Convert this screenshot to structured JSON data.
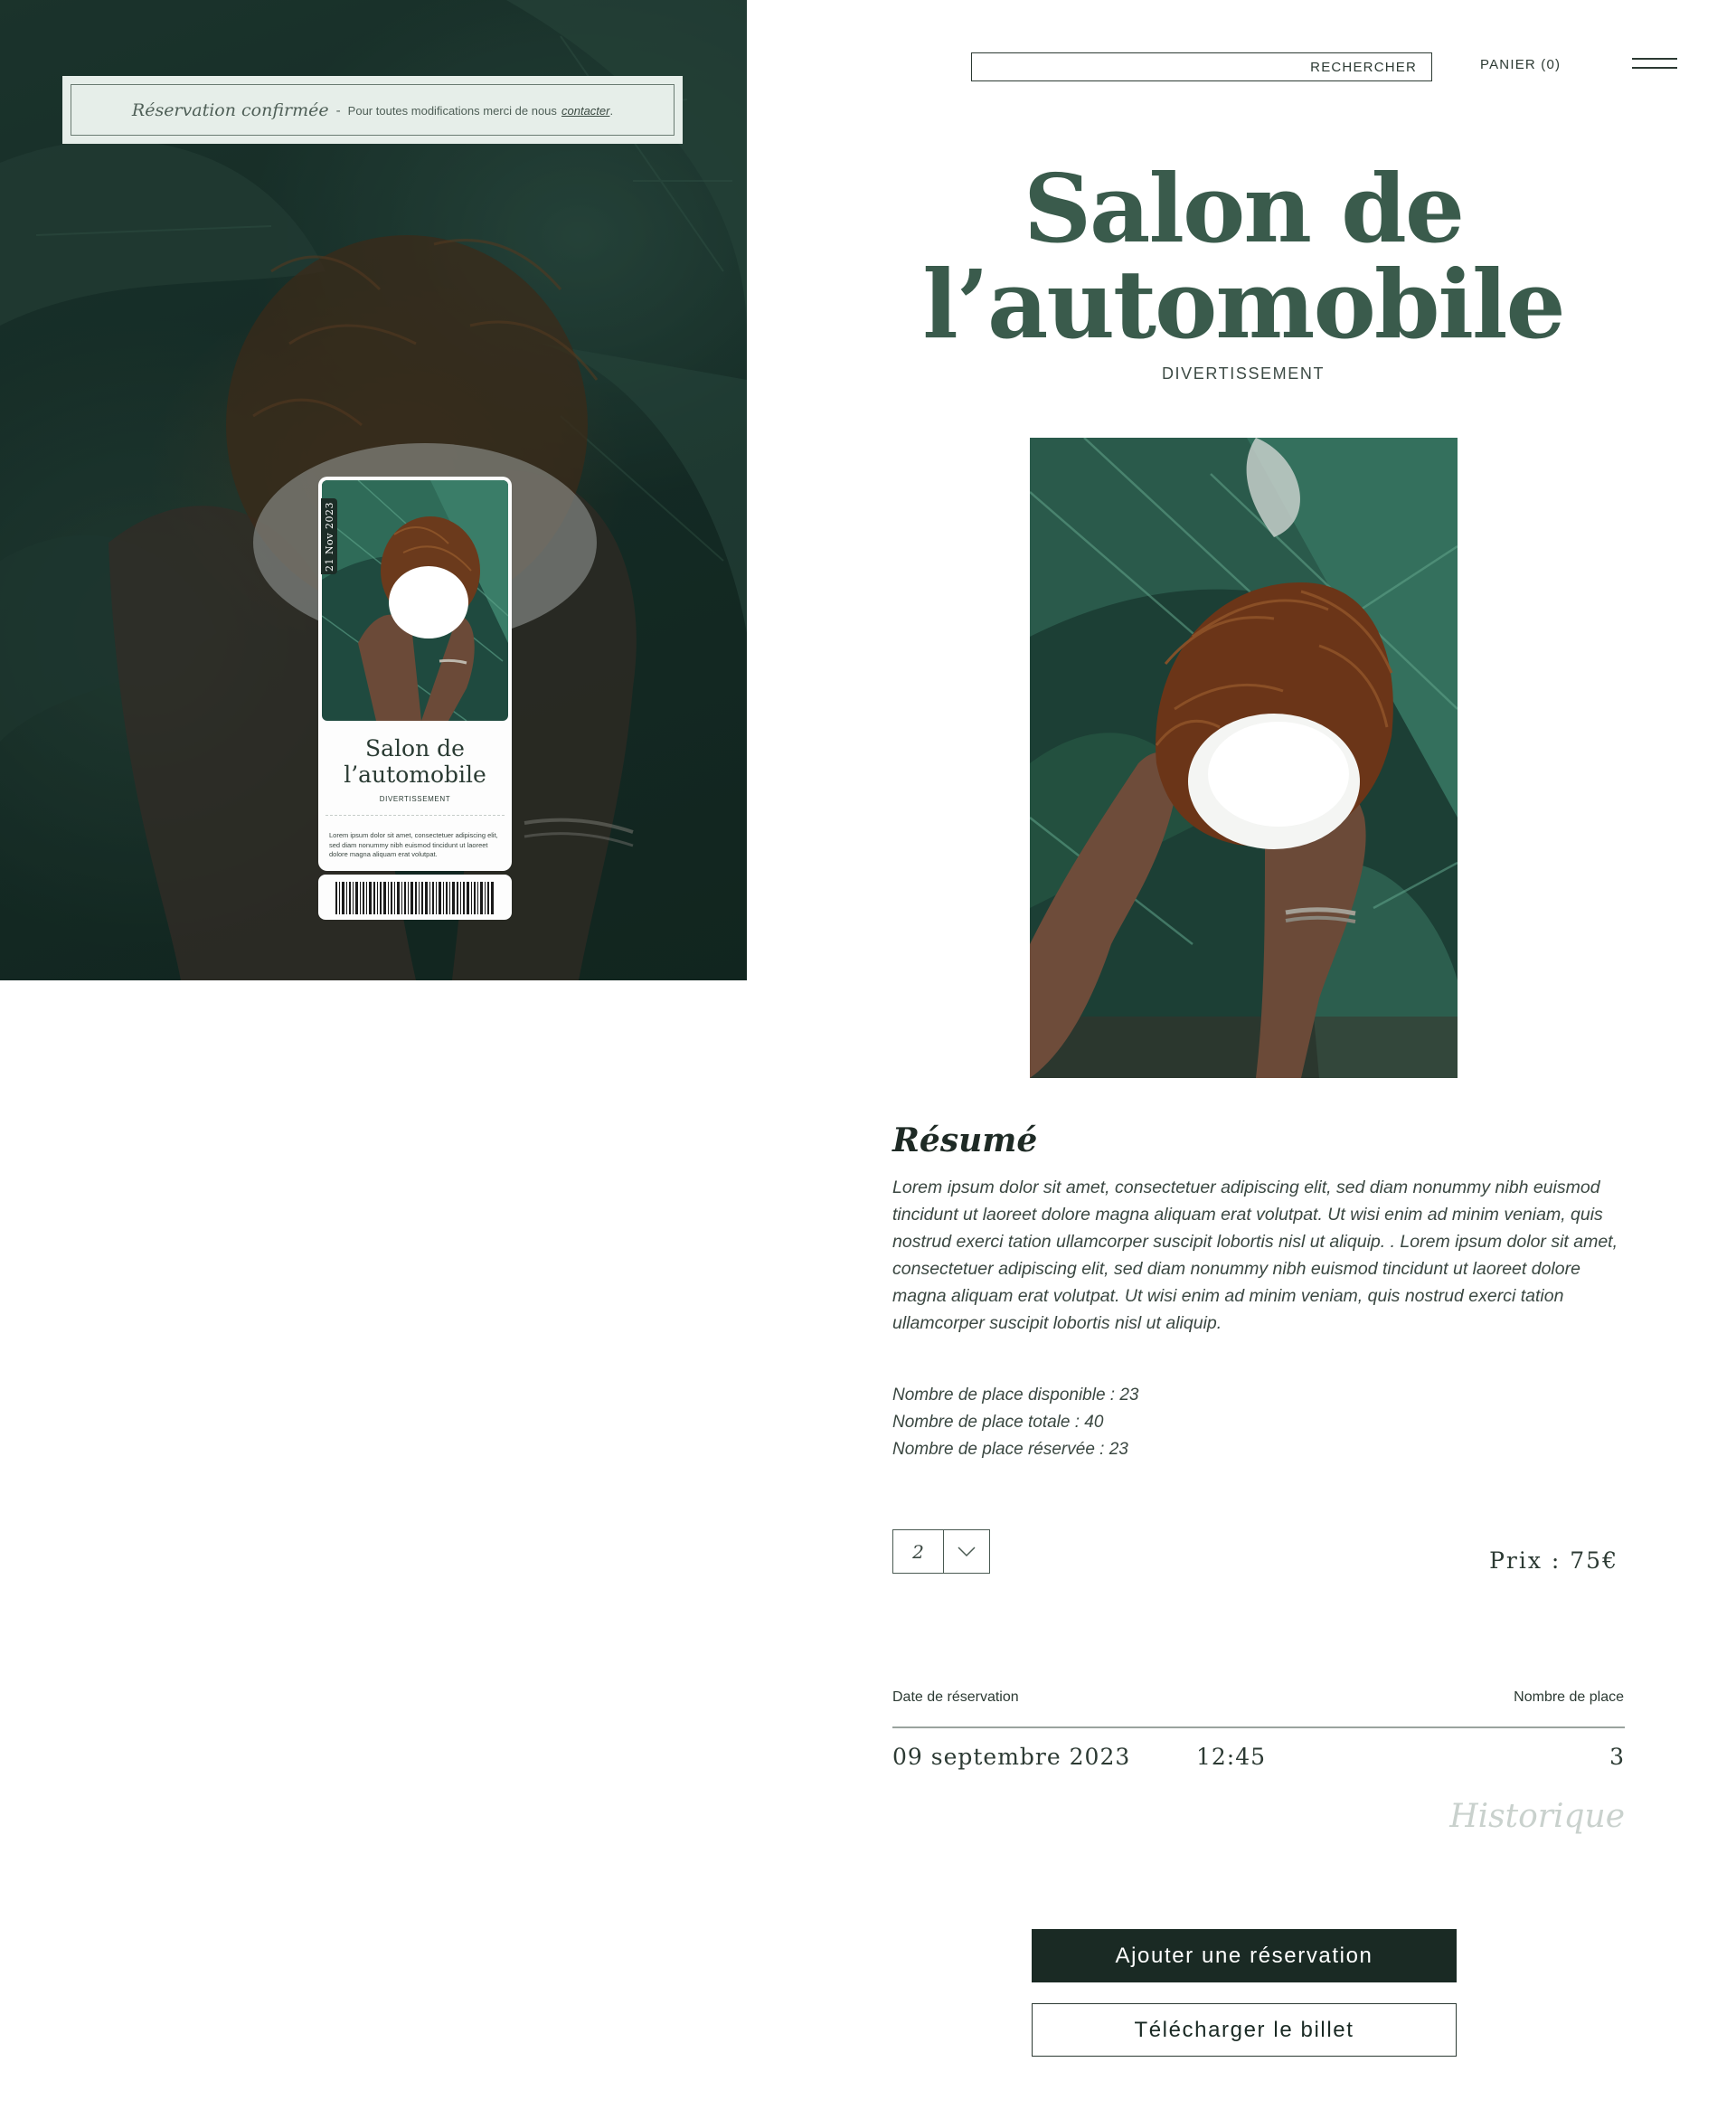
{
  "colors": {
    "brand_green": "#3a5b4c",
    "dark": "#1a2a24",
    "banner_bg": "#e6eee9",
    "muted": "#c9d1cd"
  },
  "banner": {
    "title": "Réservation confirmée",
    "separator": "-",
    "text": "Pour toutes modifications merci de nous",
    "link": "contacter",
    "after_link": "."
  },
  "ticket": {
    "date": "21 Nov 2023",
    "title_line1": "Salon de",
    "title_line2": "l’automobile",
    "category": "DIVERTISSEMENT",
    "description": "Lorem ipsum dolor sit amet, consectetuer adipiscing elit, sed diam nonummy nibh euismod tincidunt ut laoreet dolore magna aliquam erat volutpat."
  },
  "header": {
    "search_label": "RECHERCHER",
    "cart_label": "PANIER (0)",
    "menu_icon": "hamburger-icon"
  },
  "event": {
    "title_line1": "Salon de",
    "title_line2": "l’automobile",
    "category": "DIVERTISSEMENT"
  },
  "summary": {
    "heading": "Résumé",
    "text": "Lorem ipsum dolor sit amet, consectetuer adipiscing elit, sed diam nonummy nibh euismod tincidunt ut laoreet dolore magna aliquam erat volutpat. Ut wisi enim ad minim veniam, quis nostrud exerci tation ullamcorper suscipit lobortis nisl ut aliquip. . Lorem ipsum dolor sit amet, consectetuer adipiscing elit, sed diam nonummy nibh euismod tincidunt ut laoreet dolore magna aliquam erat volutpat. Ut wisi enim ad minim veniam, quis nostrud exerci tation ullamcorper suscipit lobortis nisl ut aliquip."
  },
  "places": {
    "available": "Nombre de place disponible : 23",
    "total": "Nombre de place totale : 40",
    "reserved": "Nombre de place réservée : 23"
  },
  "order": {
    "quantity": "2",
    "price_label": "Prix",
    "price_sep": ":",
    "price_value": "75€"
  },
  "reservations": {
    "headers": {
      "date": "Date de réservation",
      "places": "Nombre de place"
    },
    "rows": [
      {
        "date": "09 septembre 2023",
        "time": "12:45",
        "places": "3"
      }
    ],
    "history_link": "Historique"
  },
  "buttons": {
    "add": "Ajouter une réservation",
    "download": "Télécharger le billet"
  }
}
